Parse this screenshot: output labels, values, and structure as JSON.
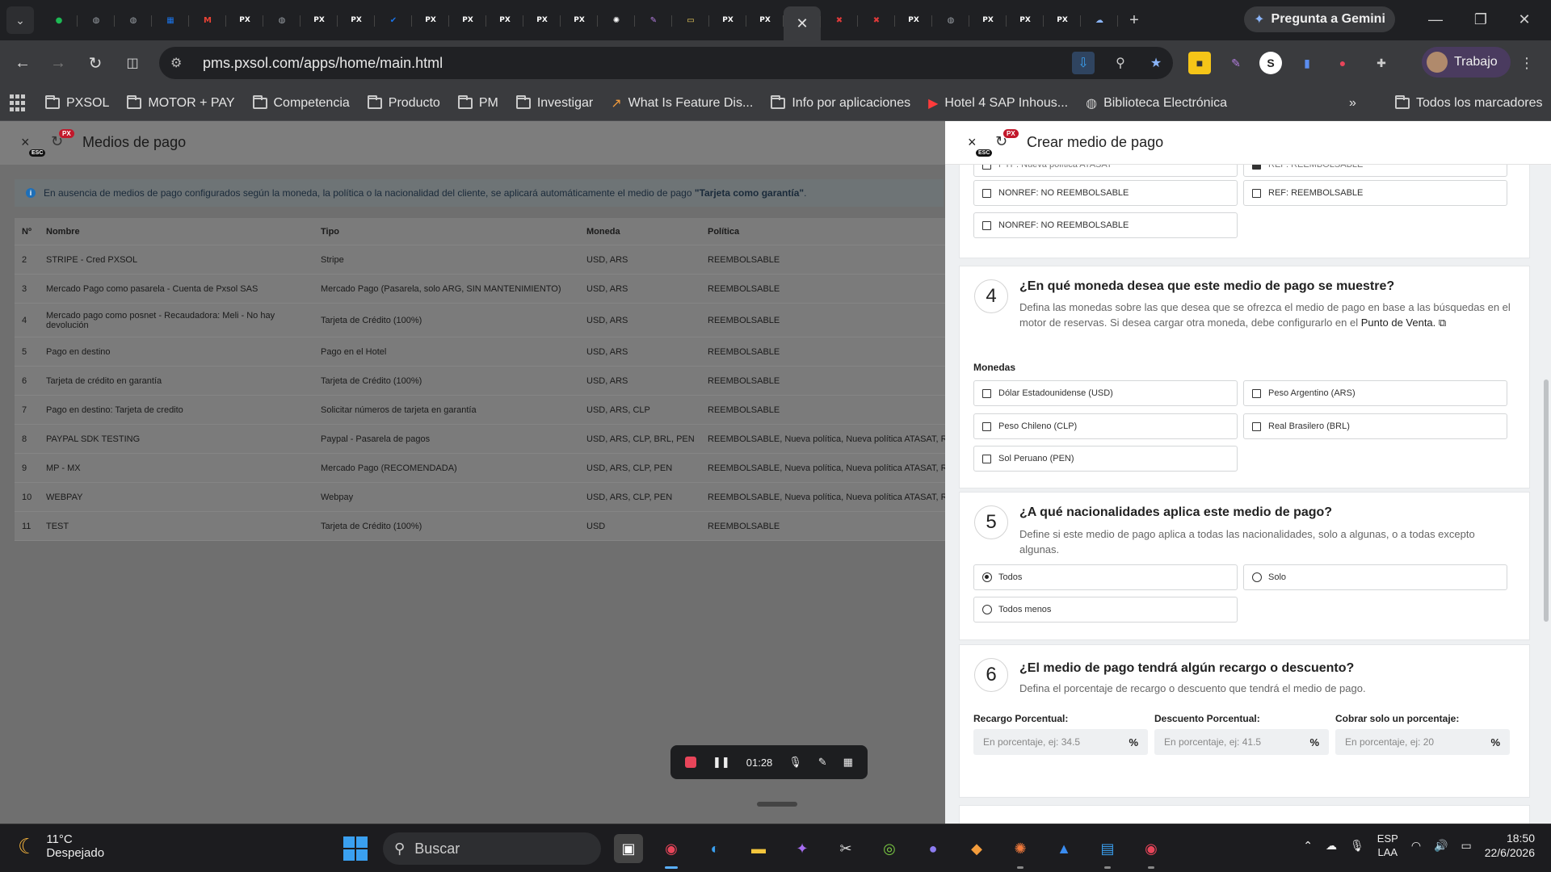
{
  "browser": {
    "tabs": [
      {
        "icon": "chevron-down-icon"
      },
      {
        "icon": "green-chat-icon",
        "color": "#1db954"
      },
      {
        "icon": "globe-icon",
        "color": "#9aa0a6"
      },
      {
        "icon": "globe-icon",
        "color": "#9aa0a6"
      },
      {
        "icon": "calendar-icon",
        "color": "#1a73e8"
      },
      {
        "icon": "gmail-icon",
        "color": "#ea4335"
      },
      {
        "icon": "px-icon",
        "color": "#ffffff"
      },
      {
        "icon": "globe-icon",
        "color": "#9aa0a6"
      },
      {
        "icon": "px-icon",
        "color": "#ffffff"
      },
      {
        "icon": "px-icon",
        "color": "#ffffff"
      },
      {
        "icon": "check-icon",
        "color": "#1a73e8"
      },
      {
        "icon": "px-icon",
        "color": "#ffffff"
      },
      {
        "icon": "px-icon",
        "color": "#ffffff"
      },
      {
        "icon": "px-icon",
        "color": "#ffffff"
      },
      {
        "icon": "px-icon",
        "color": "#ffffff"
      },
      {
        "icon": "px-icon",
        "color": "#ffffff"
      },
      {
        "icon": "openai-icon",
        "color": "#ffffff"
      },
      {
        "icon": "feather-icon",
        "color": "#b47ee0"
      },
      {
        "icon": "doc-icon",
        "color": "#f4d35e"
      },
      {
        "icon": "px-icon",
        "color": "#ffffff"
      },
      {
        "icon": "px-icon",
        "color": "#ffffff"
      },
      {
        "icon": "close-icon",
        "active": true
      },
      {
        "icon": "x-red-icon",
        "color": "#e03a3a"
      },
      {
        "icon": "x-red-icon",
        "color": "#e03a3a"
      },
      {
        "icon": "px-icon",
        "color": "#ffffff"
      },
      {
        "icon": "globe-icon",
        "color": "#9aa0a6"
      },
      {
        "icon": "px-icon",
        "color": "#ffffff"
      },
      {
        "icon": "px-icon",
        "color": "#ffffff"
      },
      {
        "icon": "px-icon",
        "color": "#ffffff"
      },
      {
        "icon": "cloud-icon",
        "color": "#8ab4f8"
      }
    ],
    "new_tab": "+",
    "gemini_label": "Pregunta a Gemini",
    "url": "pms.pxsol.com/apps/home/main.html",
    "profile_label": "Trabajo",
    "bookmarks": [
      {
        "label": "PXSOL",
        "icon": "folder-icon"
      },
      {
        "label": "MOTOR + PAY",
        "icon": "folder-icon"
      },
      {
        "label": "Competencia",
        "icon": "folder-icon"
      },
      {
        "label": "Producto",
        "icon": "folder-icon"
      },
      {
        "label": "PM",
        "icon": "folder-icon"
      },
      {
        "label": "Investigar",
        "icon": "folder-icon"
      },
      {
        "label": "What Is Feature Dis...",
        "icon": "site-icon"
      },
      {
        "label": "Info por aplicaciones",
        "icon": "folder-icon"
      },
      {
        "label": "Hotel 4 SAP Inhous...",
        "icon": "youtube-icon"
      },
      {
        "label": "Biblioteca Electrónica",
        "icon": "globe-icon"
      }
    ],
    "bookmarks_overflow": "»",
    "all_bookmarks": "Todos los marcadores"
  },
  "left": {
    "close": "×",
    "esc": "ESC",
    "px": "PX",
    "title": "Medios de pago",
    "info_prefix": "En ausencia de medios de pago configurados según la moneda, la política o la nacionalidad del cliente, se aplicará automáticamente el medio de pago ",
    "info_bold": "\"Tarjeta como garantía\"",
    "info_suffix": ".",
    "table": {
      "headers": [
        "Nº",
        "Nombre",
        "Tipo",
        "Moneda",
        "Política"
      ],
      "rows": [
        [
          "2",
          "STRIPE - Cred PXSOL",
          "Stripe",
          "USD, ARS",
          "REEMBOLSABLE"
        ],
        [
          "3",
          "Mercado Pago como pasarela - Cuenta de Pxsol SAS",
          "Mercado Pago (Pasarela, solo ARG, SIN MANTENIMIENTO)",
          "USD, ARS",
          "REEMBOLSABLE"
        ],
        [
          "4",
          "Mercado pago como posnet - Recaudadora: Meli - No hay devolución",
          "Tarjeta de Crédito (100%)",
          "USD, ARS",
          "REEMBOLSABLE"
        ],
        [
          "5",
          "Pago en destino",
          "Pago en el Hotel",
          "USD, ARS",
          "REEMBOLSABLE"
        ],
        [
          "6",
          "Tarjeta de crédito en garantía",
          "Tarjeta de Crédito (100%)",
          "USD, ARS",
          "REEMBOLSABLE"
        ],
        [
          "7",
          "Pago en destino: Tarjeta de credito",
          "Solicitar números de tarjeta en garantía",
          "USD, ARS, CLP",
          "REEMBOLSABLE"
        ],
        [
          "8",
          "PAYPAL SDK TESTING",
          "Paypal - Pasarela de pagos",
          "USD, ARS, CLP, BRL, PEN",
          "REEMBOLSABLE, Nueva política, Nueva política ATASAT, RE"
        ],
        [
          "9",
          "MP - MX",
          "Mercado Pago (RECOMENDADA)",
          "USD, ARS, CLP, PEN",
          "REEMBOLSABLE, Nueva política, Nueva política ATASAT, RE"
        ],
        [
          "10",
          "WEBPAY",
          "Webpay",
          "USD, ARS, CLP, PEN",
          "REEMBOLSABLE, Nueva política, Nueva política ATASAT, RE"
        ],
        [
          "11",
          "TEST",
          "Tarjeta de Crédito (100%)",
          "USD",
          "REEMBOLSABLE"
        ]
      ]
    }
  },
  "drawer": {
    "close": "×",
    "esc": "ESC",
    "px": "PX",
    "title": "Crear medio de pago",
    "policy_partial": {
      "top_left": "PYP: Nueva política ATASAT",
      "top_right": "REF: REEMBOLSABLE",
      "options": [
        "NONREF: NO REEMBOLSABLE",
        "REF: REEMBOLSABLE",
        "NONREF: NO REEMBOLSABLE"
      ]
    },
    "step4": {
      "num": "4",
      "title": "¿En qué moneda desea que este medio de pago se muestre?",
      "desc": "Defina las monedas sobre las que desea que se ofrezca el medio de pago en base a las búsquedas en el motor de reservas. Si desea cargar otra moneda, debe configurarlo en el ",
      "desc_link": "Punto de Venta.",
      "field_label": "Monedas",
      "options": [
        "Dólar Estadounidense (USD)",
        "Peso Argentino (ARS)",
        "Peso Chileno (CLP)",
        "Real Brasilero (BRL)",
        "Sol Peruano (PEN)"
      ]
    },
    "step5": {
      "num": "5",
      "title": "¿A qué nacionalidades aplica este medio de pago?",
      "desc": "Define si este medio de pago aplica a todas las nacionalidades, solo a algunas, o a todas excepto algunas.",
      "options": [
        "Todos",
        "Solo",
        "Todos menos"
      ],
      "selected": "Todos"
    },
    "step6": {
      "num": "6",
      "title": "¿El medio de pago tendrá algún recargo o descuento?",
      "desc": "Defina el porcentaje de recargo o descuento que tendrá el medio de pago.",
      "fields": [
        {
          "label": "Recargo Porcentual:",
          "placeholder": "En porcentaje, ej: 34.5"
        },
        {
          "label": "Descuento Porcentual:",
          "placeholder": "En porcentaje, ej: 41.5"
        },
        {
          "label": "Cobrar solo un porcentaje:",
          "placeholder": "En porcentaje, ej: 20"
        }
      ],
      "pct_symbol": "%"
    }
  },
  "recorder": {
    "time": "01:28"
  },
  "taskbar": {
    "temp": "11°C",
    "weather": "Despejado",
    "search_placeholder": "Buscar",
    "lang_line1": "ESP",
    "lang_line2": "LAA",
    "time": "18:50",
    "date": "22/6/2026"
  }
}
